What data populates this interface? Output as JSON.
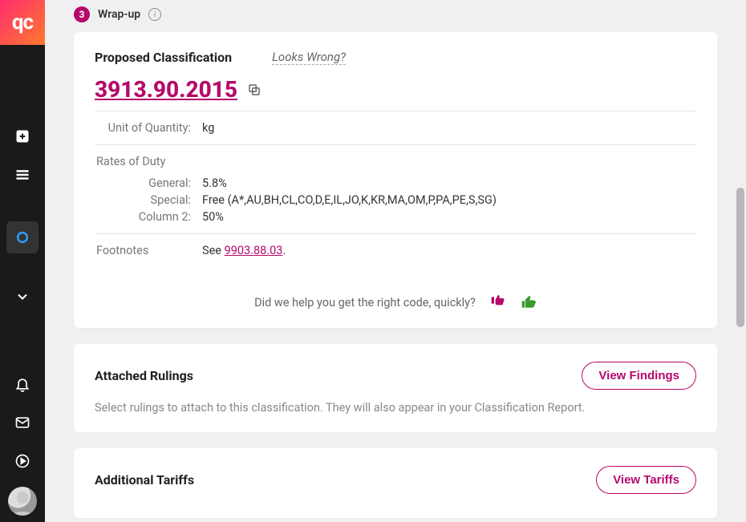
{
  "step": {
    "number": "3",
    "label": "Wrap-up"
  },
  "proposed": {
    "title": "Proposed Classification",
    "looks_wrong": "Looks Wrong?",
    "code": "3913.90.2015",
    "unit_label": "Unit of Quantity:",
    "unit_value": "kg",
    "rates_label": "Rates of Duty",
    "general_label": "General:",
    "general_value": "5.8%",
    "special_label": "Special:",
    "special_value": "Free (A*,AU,BH,CL,CO,D,E,IL,JO,K,KR,MA,OM,P,PA,PE,S,SG)",
    "column2_label": "Column 2:",
    "column2_value": "50%",
    "footnotes_label": "Footnotes",
    "footnotes_prefix": "See ",
    "footnotes_link": "9903.88.03",
    "footnotes_suffix": "."
  },
  "feedback": {
    "prompt": "Did we help you get the right code, quickly?"
  },
  "rulings": {
    "title": "Attached Rulings",
    "button": "View Findings",
    "desc": "Select rulings to attach to this classification. They will also appear in your Classification Report."
  },
  "tariffs": {
    "title": "Additional Tariffs",
    "button": "View Tariffs"
  },
  "logo_text": "qc"
}
